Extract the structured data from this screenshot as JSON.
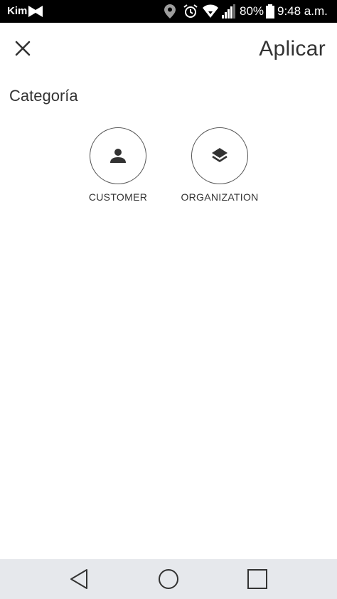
{
  "status_bar": {
    "carrier": "Kim",
    "battery": "80%",
    "time": "9:48 a.m.",
    "icons": [
      "app-notification-icon",
      "location-icon",
      "alarm-icon",
      "wifi-icon",
      "signal-icon",
      "battery-icon"
    ]
  },
  "header": {
    "close_icon": "close-icon",
    "apply_label": "Aplicar"
  },
  "section": {
    "title": "Categoría"
  },
  "categories": [
    {
      "label": "CUSTOMER",
      "icon": "person-icon"
    },
    {
      "label": "ORGANIZATION",
      "icon": "layers-icon"
    }
  ],
  "nav_bar": {
    "icons": [
      "back-icon",
      "home-icon",
      "recents-icon"
    ]
  }
}
